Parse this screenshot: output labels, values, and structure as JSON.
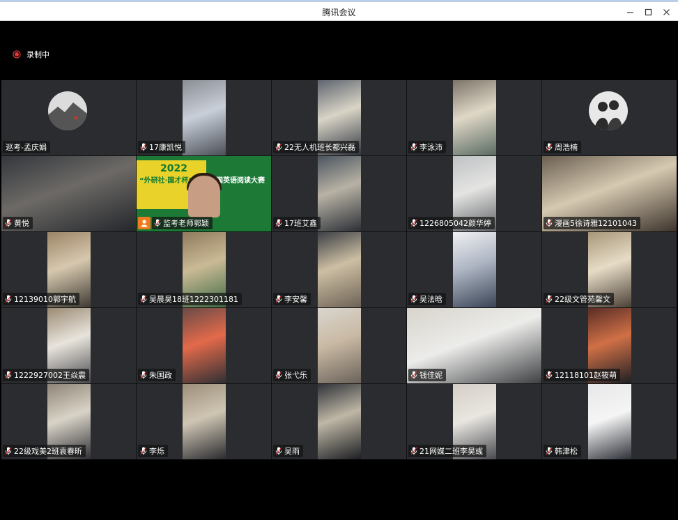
{
  "window": {
    "title": "腾讯会议",
    "controls": {
      "minimize": "minimize-icon",
      "maximize": "maximize-icon",
      "close": "close-icon"
    }
  },
  "recording": {
    "label": "录制中",
    "icon": "record-icon",
    "color": "#e23a3a"
  },
  "participants": [
    {
      "name": "巡考-孟庆娟",
      "mic": false,
      "kind": "avatar"
    },
    {
      "name": "17康凯悦",
      "mic": true
    },
    {
      "name": "22无人机班长都兴磊",
      "mic": true
    },
    {
      "name": "李泳沛",
      "mic": true
    },
    {
      "name": "周浩楠",
      "mic": true,
      "kind": "avatar"
    },
    {
      "name": "黄悦",
      "mic": true
    },
    {
      "name": "监考老师郭颖",
      "mic": true,
      "kind": "banner",
      "badge": "user-icon",
      "banner": {
        "year": "2022",
        "title": "“外研社·国才杯”",
        "main": "全国英语阅读大赛"
      }
    },
    {
      "name": "17班艾鑫",
      "mic": true
    },
    {
      "name": "1226805042颜华婷",
      "mic": true
    },
    {
      "name": "漫画5徐诗雅12101043",
      "mic": true
    },
    {
      "name": "12139010郭宇航",
      "mic": true
    },
    {
      "name": "吴晨昊18班1222301181",
      "mic": true
    },
    {
      "name": "李安馨",
      "mic": true
    },
    {
      "name": "吴法晗",
      "mic": true
    },
    {
      "name": "22级文管苑馨文",
      "mic": true
    },
    {
      "name": "1222927002王焱震",
      "mic": true
    },
    {
      "name": "朱国政",
      "mic": true
    },
    {
      "name": "张弋乐",
      "mic": true
    },
    {
      "name": "钱佳妮",
      "mic": true
    },
    {
      "name": "12118101赵筱萌",
      "mic": true
    },
    {
      "name": "22级戏美2班袁春昕",
      "mic": true
    },
    {
      "name": "李烁",
      "mic": true
    },
    {
      "name": "吴雨",
      "mic": true
    },
    {
      "name": "21网媒二班李昊彧",
      "mic": true
    },
    {
      "name": "韩津松",
      "mic": true
    }
  ],
  "colors": {
    "tile_bg": "#2a2c2f",
    "label_bg": "#141414",
    "badge": "#f07b1e"
  }
}
